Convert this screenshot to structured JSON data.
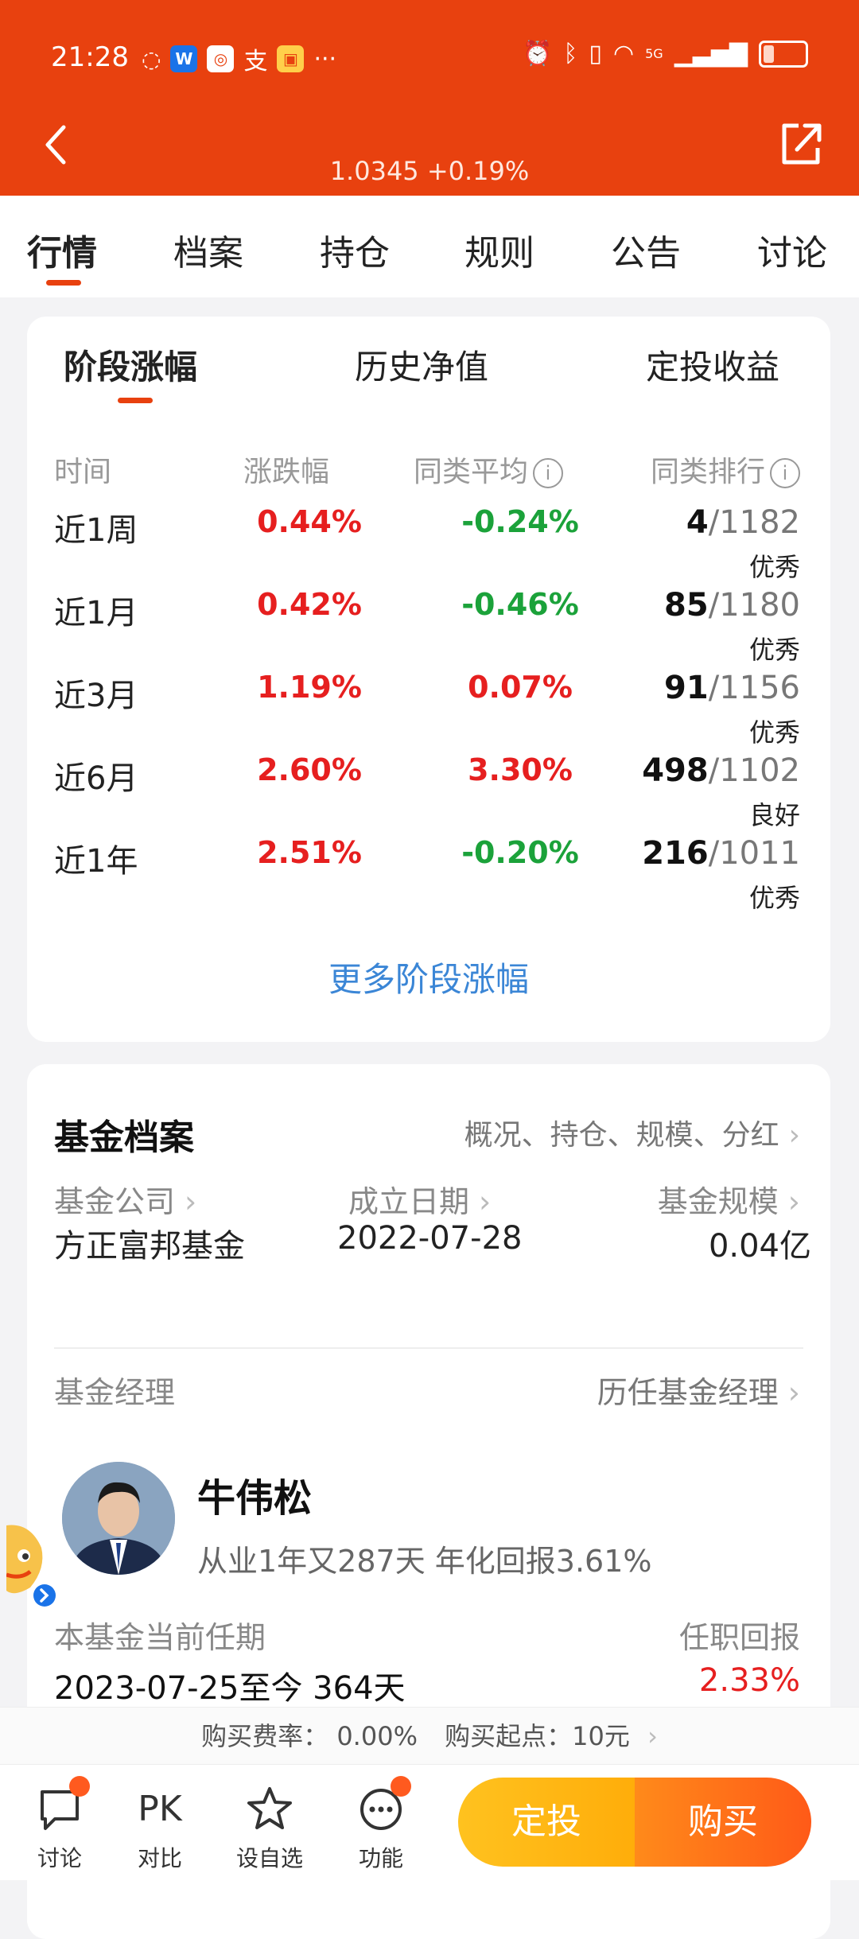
{
  "status_bar": {
    "time": "21:28",
    "signal_label": "5G",
    "battery_level": 0.25
  },
  "header": {
    "nav_price": "1.0345 +0.19%"
  },
  "tabs": [
    {
      "label": "行情"
    },
    {
      "label": "档案"
    },
    {
      "label": "持仓"
    },
    {
      "label": "规则"
    },
    {
      "label": "公告"
    },
    {
      "label": "讨论"
    }
  ],
  "performance": {
    "subtabs": [
      {
        "label": "阶段涨幅"
      },
      {
        "label": "历史净值"
      },
      {
        "label": "定投收益"
      }
    ],
    "headers": {
      "period": "时间",
      "change": "涨跌幅",
      "peer_avg": "同类平均",
      "peer_rank": "同类排行"
    },
    "rows": [
      {
        "period": "近1周",
        "change": "0.44%",
        "peer_avg": "-0.24%",
        "rank": "4",
        "total": "/1182",
        "level": "优秀"
      },
      {
        "period": "近1月",
        "change": "0.42%",
        "peer_avg": "-0.46%",
        "rank": "85",
        "total": "/1180",
        "level": "优秀"
      },
      {
        "period": "近3月",
        "change": "1.19%",
        "peer_avg": "0.07%",
        "rank": "91",
        "total": "/1156",
        "level": "优秀"
      },
      {
        "period": "近6月",
        "change": "2.60%",
        "peer_avg": "3.30%",
        "rank": "498",
        "total": "/1102",
        "level": "良好"
      },
      {
        "period": "近1年",
        "change": "2.51%",
        "peer_avg": "-0.20%",
        "rank": "216",
        "total": "/1011",
        "level": "优秀"
      }
    ],
    "more_link": "更多阶段涨幅"
  },
  "profile": {
    "title": "基金档案",
    "tags": "概况、持仓、规模、分红",
    "company_label": "基金公司",
    "company_value": "方正富邦基金",
    "date_label": "成立日期",
    "date_value": "2022-07-28",
    "size_label": "基金规模",
    "size_value": "0.04亿",
    "manager_label": "基金经理",
    "manager_history": "历任基金经理",
    "manager_name": "牛伟松",
    "manager_desc": "从业1年又287天 年化回报3.61%",
    "term_label": "本基金当前任期",
    "term_value": "2023-07-25至今 364天",
    "return_label": "任职回报",
    "return_value": "2.33%"
  },
  "purchase_info": {
    "fee_label": "购买费率：",
    "fee_value": "0.00%",
    "min_label": "购买起点：",
    "min_value": "10元"
  },
  "bottom_nav": [
    {
      "label": "讨论"
    },
    {
      "label": "对比"
    },
    {
      "label": "设自选"
    },
    {
      "label": "功能"
    }
  ],
  "bottom_nav_pk": "PK",
  "cta": {
    "dingtou": "定投",
    "buy": "购买"
  },
  "colors": {
    "brand": "#e8410f",
    "up": "#e61f1f",
    "down": "#1ba23a",
    "link": "#3b86d6"
  }
}
